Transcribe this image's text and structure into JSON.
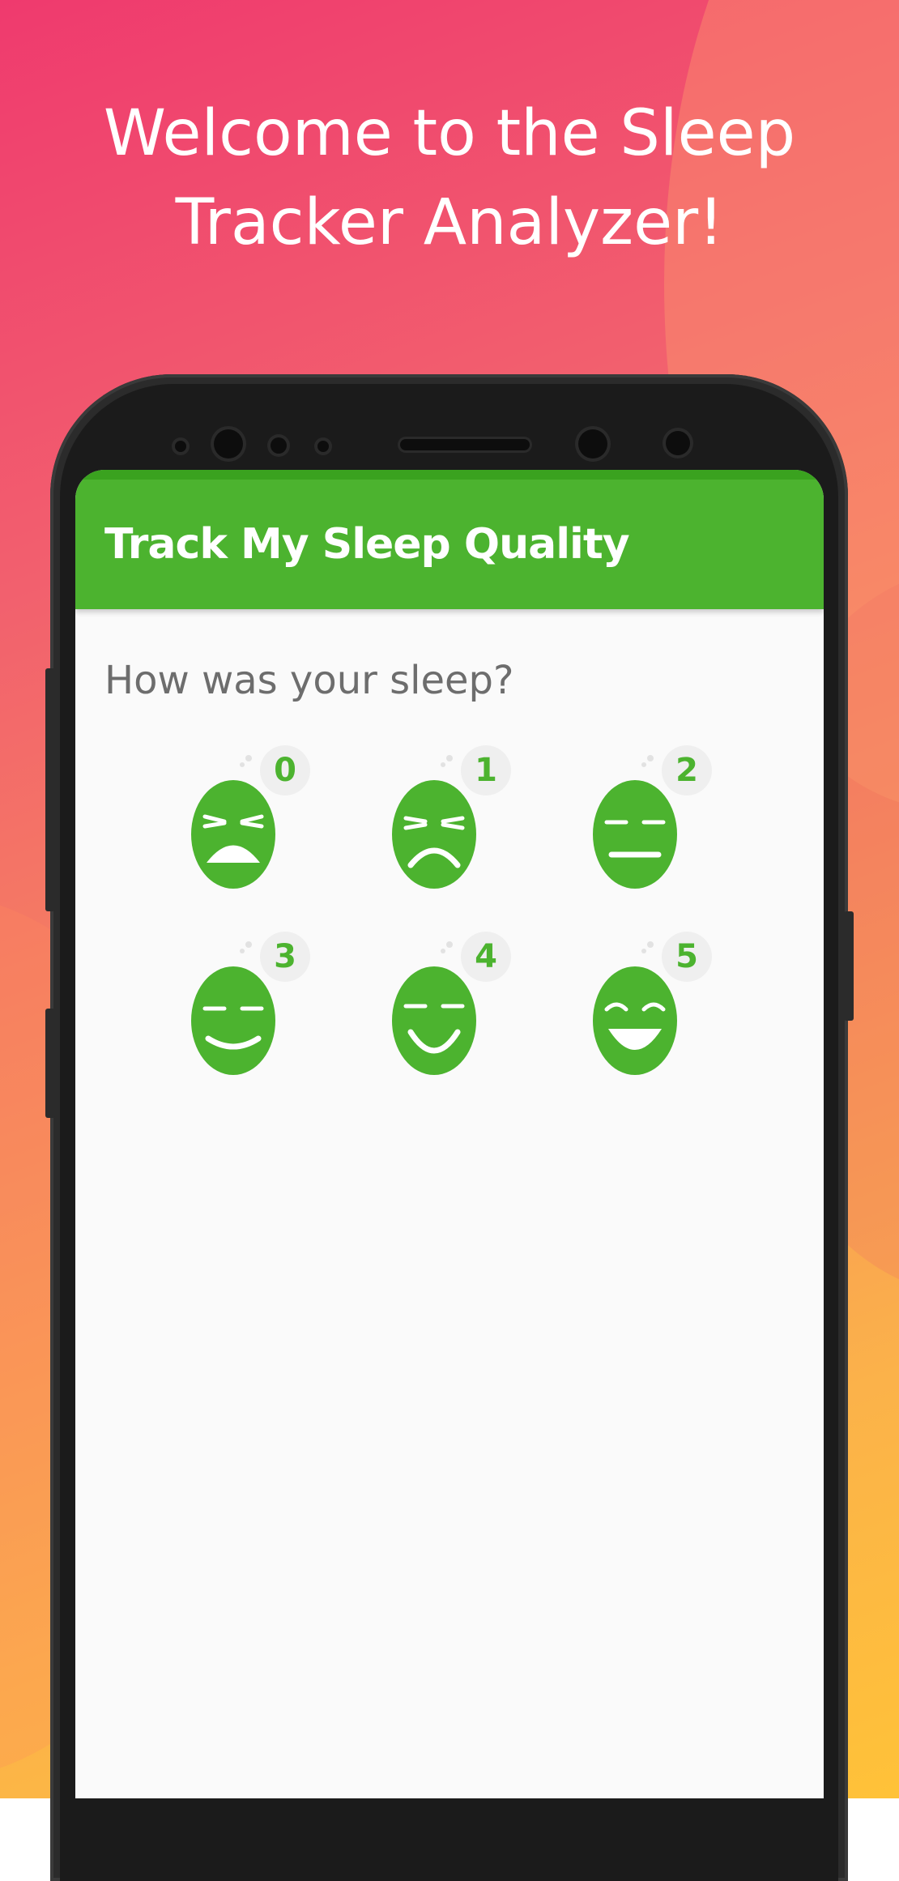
{
  "headline": {
    "line1": "Welcome to the Sleep",
    "line2": "Tracker Analyzer!"
  },
  "app": {
    "title": "Track My Sleep Quality",
    "question": "How was your sleep?",
    "accent_color": "#4cb32f",
    "ratings": [
      {
        "value": "0",
        "face": "very-bad-face-icon"
      },
      {
        "value": "1",
        "face": "bad-face-icon"
      },
      {
        "value": "2",
        "face": "neutral-face-icon"
      },
      {
        "value": "3",
        "face": "slight-smile-face-icon"
      },
      {
        "value": "4",
        "face": "smile-face-icon"
      },
      {
        "value": "5",
        "face": "laugh-face-icon"
      }
    ]
  }
}
